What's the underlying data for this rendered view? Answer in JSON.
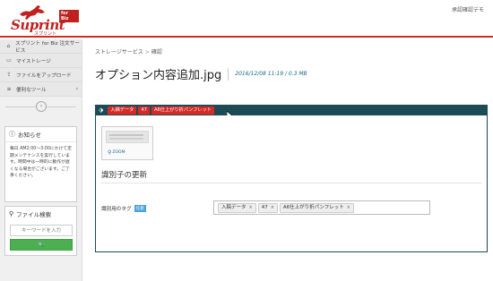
{
  "header": {
    "logo": {
      "wordmark": "Suprint",
      "badge": "for Biz",
      "subtitle": "スプリント"
    },
    "user": "承認確認デモ"
  },
  "sidebar": {
    "items": [
      {
        "label": "スプリント for Biz 注文サービス",
        "icon": "home-icon"
      },
      {
        "label": "マイストレージ",
        "icon": "folder-icon"
      },
      {
        "label": "ファイルをアップロード",
        "icon": "upload-icon"
      },
      {
        "label": "便利なツール",
        "icon": "menu-icon"
      }
    ],
    "collapse_glyph": "‹",
    "notice": {
      "title": "お知らせ",
      "body": "毎日 AM2:00〜3:00にかけて定期メンテナンスを実行しています。時間中は一時的に動作が遅くなる場合がございます。ご了承ください。"
    },
    "file_search": {
      "title": "ファイル検索",
      "placeholder": "キーワードを入力",
      "button_glyph": "🔍"
    }
  },
  "main": {
    "breadcrumb": {
      "parent": "ストレージサービス",
      "separator": ">",
      "current": "確認"
    },
    "title": "オプション内容追加.jpg",
    "meta": "2016/12/08 11:19 / 0.3 MB",
    "tagbar": {
      "chips": [
        "入稿データ",
        "47",
        "A6仕上がり折パンフレット"
      ]
    },
    "thumbnail": {
      "zoom_label": "ZOOM"
    },
    "section_title": "識別子の更新",
    "tag_field": {
      "label": "識別用のタグ",
      "badge": "任意",
      "tokens": [
        "入稿データ",
        "47",
        "A6仕上がり折パンフレット"
      ]
    }
  },
  "colors": {
    "brand_red": "#d62a26",
    "tagbar": "#1d4a57",
    "search_green": "#4caf50",
    "meta_blue": "#1b6a8a"
  }
}
